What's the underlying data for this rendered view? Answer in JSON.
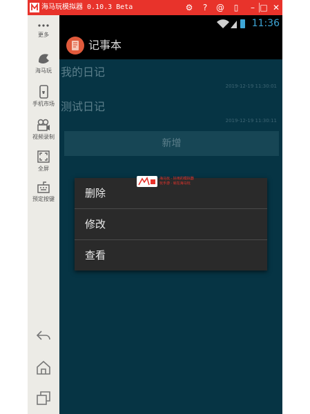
{
  "emulator": {
    "title": "海马玩模拟器 0.10.3 Beta",
    "sidebar": {
      "more_label": "更多",
      "items": [
        {
          "label": "海马玩",
          "icon": "haima-logo-icon"
        },
        {
          "label": "手机市场",
          "icon": "phone-market-icon"
        },
        {
          "label": "视频录制",
          "icon": "video-record-icon"
        },
        {
          "label": "全屏",
          "icon": "fullscreen-icon"
        },
        {
          "label": "预定按键",
          "icon": "keymap-icon"
        }
      ]
    }
  },
  "status_bar": {
    "time": "11:36"
  },
  "app": {
    "title": "记事本",
    "notes": [
      {
        "title": "我的日记",
        "date": "2019-12-19 11:30:01"
      },
      {
        "title": "测试日记",
        "date": "2019-12-19 11:30:11"
      }
    ],
    "add_button": "新增"
  },
  "context_menu": {
    "items": [
      "删除",
      "修改",
      "查看"
    ]
  },
  "watermark": {
    "line1": "海马玩 · 好用的模拟器",
    "line2": "玩手游 · 就在海马玩"
  },
  "colors": {
    "title_bar": "#e8332b",
    "screen_background": "#063444",
    "menu_background": "#2a2a2a",
    "status_time": "#3ea6d6"
  }
}
